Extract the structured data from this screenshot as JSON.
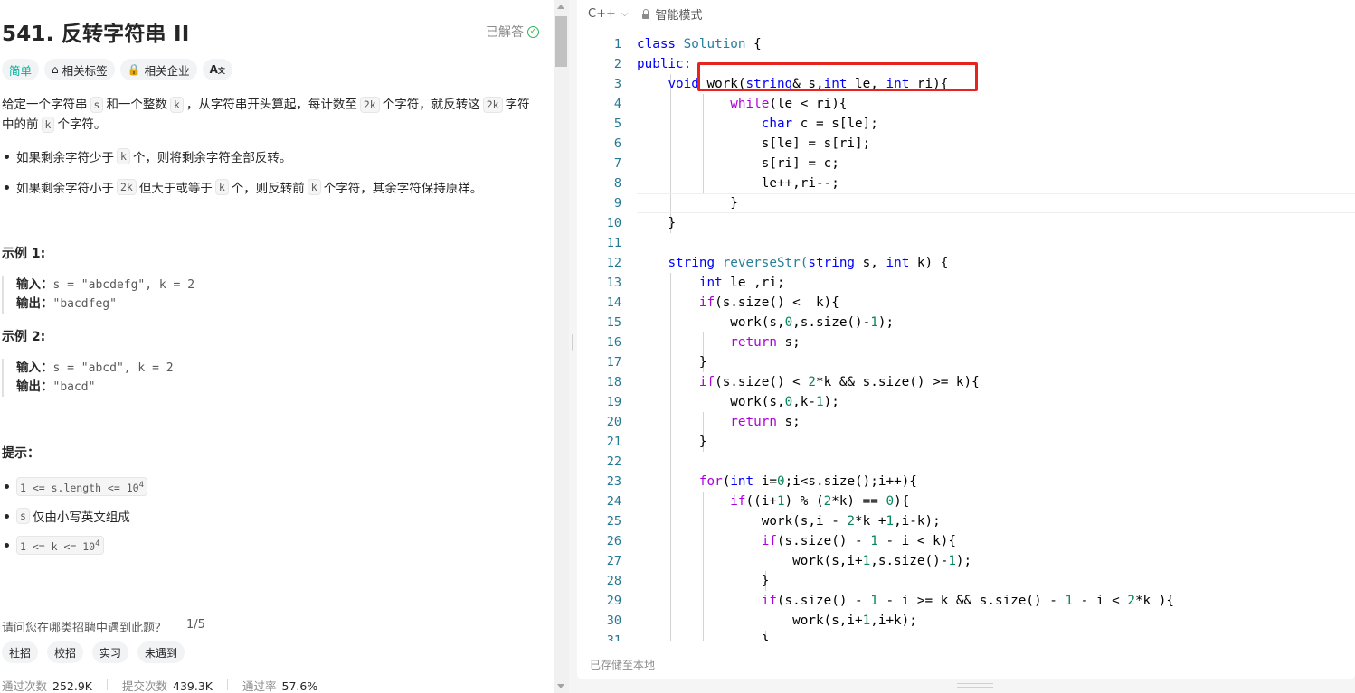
{
  "problem": {
    "title": "541. 反转字符串 II",
    "status": "已解答",
    "tags": {
      "difficulty": "简单",
      "related_tags": "相关标签",
      "related_companies": "相关企业",
      "font_icon": "A",
      "font_icon_sub": "文"
    },
    "desc_1": "给定一个字符串",
    "desc_s": "s",
    "desc_2": "和一个整数",
    "desc_k": "k",
    "desc_3": "，从字符串开头算起，每计数至",
    "desc_2k": "2k",
    "desc_4": "个字符，就反转这",
    "desc_2k_b": "2k",
    "desc_5": "字符",
    "desc_6": "中的前",
    "desc_k_b": "k",
    "desc_7": "个字符。",
    "bullet1_a": "如果剩余字符少于",
    "bullet1_k": "k",
    "bullet1_b": "个，则将剩余字符全部反转。",
    "bullet2_a": "如果剩余字符小于",
    "bullet2_2k": "2k",
    "bullet2_b": "但大于或等于",
    "bullet2_k": "k",
    "bullet2_c": "个，则反转前",
    "bullet2_k2": "k",
    "bullet2_d": "个字符，其余字符保持原样。",
    "example1": {
      "heading": "示例 1:",
      "input_label": "输入：",
      "input": "s = \"abcdefg\", k = 2",
      "output_label": "输出：",
      "output": "\"bacdfeg\""
    },
    "example2": {
      "heading": "示例 2:",
      "input_label": "输入：",
      "input": "s = \"abcd\", k = 2",
      "output_label": "输出：",
      "output": "\"bacd\""
    },
    "hints_heading": "提示：",
    "hint1": "1 <= s.length <= 10",
    "hint1_sup": "4",
    "hint2_code": "s",
    "hint2_text": "仅由小写英文组成",
    "hint3": "1 <= k <= 10",
    "hint3_sup": "4",
    "survey_q": "请问您在哪类招聘中遇到此题？",
    "survey_count": "1/5",
    "chips": [
      "社招",
      "校招",
      "实习",
      "未遇到"
    ],
    "stats": {
      "accepted_label": "通过次数",
      "accepted": "252.9K",
      "submitted_label": "提交次数",
      "submitted": "439.3K",
      "rate_label": "通过率",
      "rate": "57.6%"
    }
  },
  "editor": {
    "language": "C++",
    "mode": "智能模式",
    "saved_status": "已存储至本地",
    "lines": [
      "1",
      "2",
      "3",
      "4",
      "5",
      "6",
      "7",
      "8",
      "9",
      "10",
      "11",
      "12",
      "13",
      "14",
      "15",
      "16",
      "17",
      "18",
      "19",
      "20",
      "21",
      "22",
      "23",
      "24",
      "25",
      "26",
      "27",
      "28",
      "29",
      "30",
      "31"
    ],
    "code": {
      "l1_kw": "class",
      "l1_ty": "Solution",
      "l1_rest": " {",
      "l2": "public:",
      "l3_kw": "void",
      "l3_a": " work(",
      "l3_kw2": "string",
      "l3_b": "& s,",
      "l3_kw3": "int",
      "l3_c": " le, ",
      "l3_kw4": "int",
      "l3_d": " ri){",
      "l4_ctl": "while",
      "l4_rest": "(le < ri){",
      "l5_kw": "char",
      "l5_rest": " c = s[le];",
      "l6": "s[le] = s[ri];",
      "l7": "s[ri] = c;",
      "l8": "le++,ri--;",
      "l9": "}",
      "l10": "}",
      "l12_kw": "string",
      "l12_a": " reverseStr(",
      "l12_kw2": "string",
      "l12_b": " s, ",
      "l12_kw3": "int",
      "l12_c": " k) {",
      "l13_kw": "int",
      "l13_rest": " le ,ri;",
      "l14_ctl": "if",
      "l14_rest": "(s.size() <  k){",
      "l15_a": "work(s,",
      "l15_n1": "0",
      "l15_b": ",s.size()-",
      "l15_n2": "1",
      "l15_c": ");",
      "l16_ctl": "return",
      "l16_rest": " s;",
      "l17": "}",
      "l18_ctl": "if",
      "l18_a": "(s.size() < ",
      "l18_n": "2",
      "l18_b": "*k && s.size() >= k){",
      "l19_a": "work(s,",
      "l19_n1": "0",
      "l19_b": ",k-",
      "l19_n2": "1",
      "l19_c": ");",
      "l20_ctl": "return",
      "l20_rest": " s;",
      "l21": "}",
      "l23_ctl": "for",
      "l23_a": "(",
      "l23_kw": "int",
      "l23_b": " i=",
      "l23_n": "0",
      "l23_c": ";i<s.size();i++){",
      "l24_ctl": "if",
      "l24_a": "((i+",
      "l24_n1": "1",
      "l24_b": ") % (",
      "l24_n2": "2",
      "l24_c": "*k) == ",
      "l24_n3": "0",
      "l24_d": "){",
      "l25_a": "work(s,i - ",
      "l25_n1": "2",
      "l25_b": "*k +",
      "l25_n2": "1",
      "l25_c": ",i-k);",
      "l26_ctl": "if",
      "l26_a": "(s.size() - ",
      "l26_n1": "1",
      "l26_b": " - i < k){",
      "l27_a": "work(s,i+",
      "l27_n1": "1",
      "l27_b": ",s.size()-",
      "l27_n2": "1",
      "l27_c": ");",
      "l28": "}",
      "l29_ctl": "if",
      "l29_a": "(s.size() - ",
      "l29_n1": "1",
      "l29_b": " - i >= k && s.size() - ",
      "l29_n2": "1",
      "l29_c": " - i < ",
      "l29_n3": "2",
      "l29_d": "*k ){",
      "l30_a": "work(s,i+",
      "l30_n1": "1",
      "l30_b": ",i+k);",
      "l31": "}"
    }
  },
  "colors": {
    "easy": "#00af9b",
    "keyword": "#0000ff",
    "control": "#af00db",
    "type": "#267f99",
    "number": "#098658",
    "line_number": "#237893",
    "highlight_box": "#e8231f",
    "solved": "#2db55d"
  }
}
